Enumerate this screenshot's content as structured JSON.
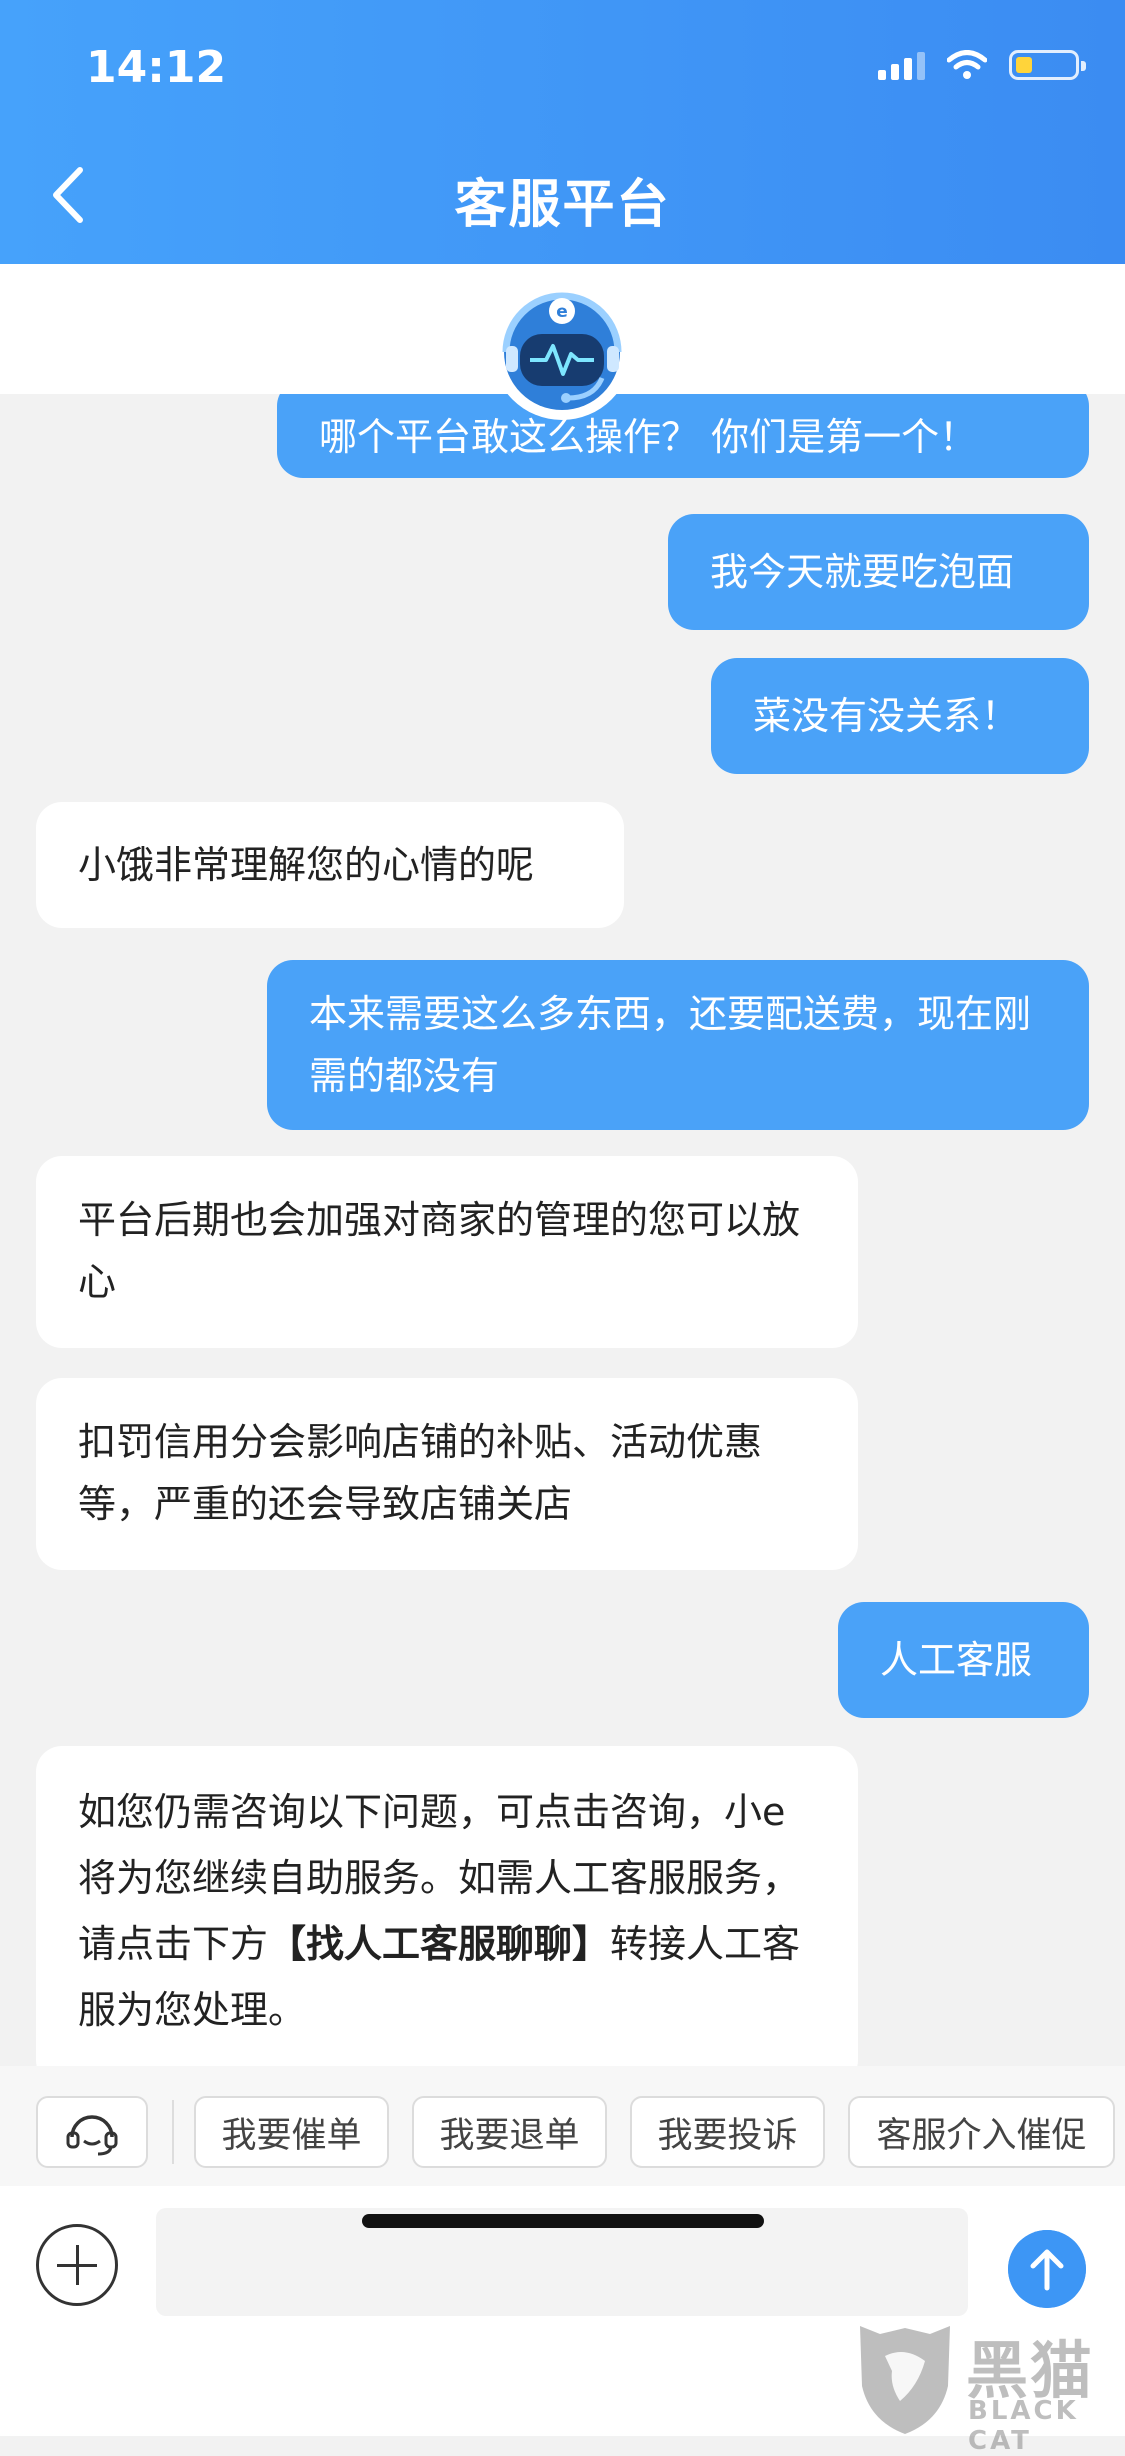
{
  "status_bar": {
    "time": "14:12"
  },
  "header": {
    "title": "客服平台"
  },
  "messages": [
    {
      "sender": "user",
      "text": "哪个平台敢这么操作？ 你们是第一个！"
    },
    {
      "sender": "user",
      "text": "我今天就要吃泡面"
    },
    {
      "sender": "user",
      "text": "菜没有没关系！"
    },
    {
      "sender": "bot",
      "text": "小饿非常理解您的心情的呢"
    },
    {
      "sender": "user",
      "text": "本来需要这么多东西，还要配送费，现在刚需的都没有"
    },
    {
      "sender": "bot",
      "text": "平台后期也会加强对商家的管理的您可以放心"
    },
    {
      "sender": "bot",
      "text": "扣罚信用分会影响店铺的补贴、活动优惠等，严重的还会导致店铺关店"
    },
    {
      "sender": "user",
      "text": "人工客服"
    },
    {
      "sender": "bot",
      "text_before": "如您仍需咨询以下问题，可点击咨询，小e将为您继续自助服务。如需人工客服服务，请点击下方",
      "text_bold": "【找人工客服聊聊】",
      "text_after": "转接人工客服为您处理。"
    }
  ],
  "quick_actions": [
    "我要催单",
    "我要退单",
    "我要投诉",
    "客服介入催促"
  ],
  "input": {
    "placeholder": ""
  },
  "watermark": {
    "cn": "黑猫",
    "en": "BLACK CAT"
  },
  "colors": {
    "header": "#3b8cf2",
    "user_bubble": "#4aa2f8",
    "send_button": "#3d96f5"
  },
  "icons": [
    "back-chevron-icon",
    "signal-icon",
    "wifi-icon",
    "battery-icon",
    "customer-service-avatar-icon",
    "headset-icon",
    "plus-icon",
    "send-arrow-icon"
  ]
}
